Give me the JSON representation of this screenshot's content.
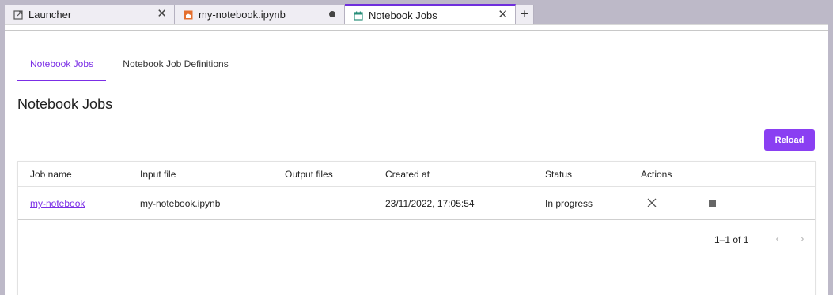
{
  "tabs": [
    {
      "label": "Launcher",
      "icon": "launcher-icon"
    },
    {
      "label": "my-notebook.ipynb",
      "icon": "notebook-icon",
      "modified": true
    },
    {
      "label": "Notebook Jobs",
      "icon": "calendar-icon",
      "active": true
    }
  ],
  "subtabs": {
    "jobs": "Notebook Jobs",
    "definitions": "Notebook Job Definitions"
  },
  "page_title": "Notebook Jobs",
  "reload_label": "Reload",
  "table": {
    "headers": {
      "job_name": "Job name",
      "input_file": "Input file",
      "output_files": "Output files",
      "created_at": "Created at",
      "status": "Status",
      "actions": "Actions"
    },
    "rows": [
      {
        "job_name": "my-notebook",
        "input_file": "my-notebook.ipynb",
        "output_files": "",
        "created_at": "23/11/2022, 17:05:54",
        "status": "In progress"
      }
    ]
  },
  "pagination": {
    "range": "1–1 of 1"
  },
  "colors": {
    "accent": "#8a3ff2",
    "link": "#7b2ee6",
    "tab_bar": "#bdb9c8"
  }
}
